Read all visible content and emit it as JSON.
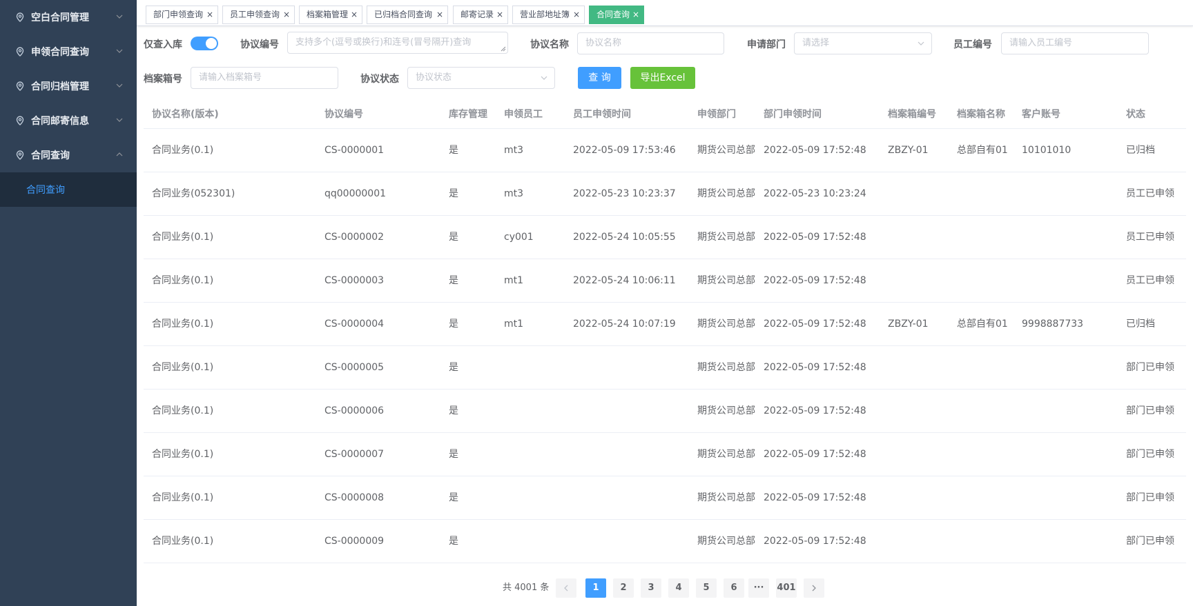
{
  "sidebar": {
    "items": [
      {
        "label": "空白合同管理"
      },
      {
        "label": "申领合同查询"
      },
      {
        "label": "合同归档管理"
      },
      {
        "label": "合同邮寄信息"
      },
      {
        "label": "合同查询"
      }
    ],
    "submenu": [
      {
        "label": "合同查询"
      }
    ]
  },
  "tabs": [
    {
      "label": "部门申领查询"
    },
    {
      "label": "员工申领查询"
    },
    {
      "label": "档案箱管理"
    },
    {
      "label": "已归档合同查询"
    },
    {
      "label": "邮寄记录"
    },
    {
      "label": "营业部地址簿"
    },
    {
      "label": "合同查询",
      "active": true
    }
  ],
  "filters": {
    "in_stock_label": "仅查入库",
    "in_stock_on": true,
    "agreement_no_label": "协议编号",
    "agreement_no_placeholder": "支持多个(逗号或换行)和连号(冒号隔开)查询",
    "agreement_name_label": "协议名称",
    "agreement_name_placeholder": "协议名称",
    "dept_label": "申请部门",
    "dept_placeholder": "请选择",
    "employee_no_label": "员工编号",
    "employee_no_placeholder": "请输入员工编号",
    "box_no_label": "档案箱号",
    "box_no_placeholder": "请输入档案箱号",
    "status_label": "协议状态",
    "status_placeholder": "协议状态",
    "query_button": "查 询",
    "export_button": "导出Excel"
  },
  "table": {
    "columns": [
      "协议名称(版本)",
      "协议编号",
      "库存管理",
      "申领员工",
      "员工申领时间",
      "申领部门",
      "部门申领时间",
      "档案箱编号",
      "档案箱名称",
      "客户账号",
      "状态"
    ],
    "rows": [
      [
        "合同业务(0.1)",
        "CS-0000001",
        "是",
        "mt3",
        "2022-05-09 17:53:46",
        "期货公司总部",
        "2022-05-09 17:52:48",
        "ZBZY-01",
        "总部自有01",
        "10101010",
        "已归档"
      ],
      [
        "合同业务(052301)",
        "qq00000001",
        "是",
        "mt3",
        "2022-05-23 10:23:37",
        "期货公司总部",
        "2022-05-23 10:23:24",
        "",
        "",
        "",
        "员工已申领"
      ],
      [
        "合同业务(0.1)",
        "CS-0000002",
        "是",
        "cy001",
        "2022-05-24 10:05:55",
        "期货公司总部",
        "2022-05-09 17:52:48",
        "",
        "",
        "",
        "员工已申领"
      ],
      [
        "合同业务(0.1)",
        "CS-0000003",
        "是",
        "mt1",
        "2022-05-24 10:06:11",
        "期货公司总部",
        "2022-05-09 17:52:48",
        "",
        "",
        "",
        "员工已申领"
      ],
      [
        "合同业务(0.1)",
        "CS-0000004",
        "是",
        "mt1",
        "2022-05-24 10:07:19",
        "期货公司总部",
        "2022-05-09 17:52:48",
        "ZBZY-01",
        "总部自有01",
        "9998887733",
        "已归档"
      ],
      [
        "合同业务(0.1)",
        "CS-0000005",
        "是",
        "",
        "",
        "期货公司总部",
        "2022-05-09 17:52:48",
        "",
        "",
        "",
        "部门已申领"
      ],
      [
        "合同业务(0.1)",
        "CS-0000006",
        "是",
        "",
        "",
        "期货公司总部",
        "2022-05-09 17:52:48",
        "",
        "",
        "",
        "部门已申领"
      ],
      [
        "合同业务(0.1)",
        "CS-0000007",
        "是",
        "",
        "",
        "期货公司总部",
        "2022-05-09 17:52:48",
        "",
        "",
        "",
        "部门已申领"
      ],
      [
        "合同业务(0.1)",
        "CS-0000008",
        "是",
        "",
        "",
        "期货公司总部",
        "2022-05-09 17:52:48",
        "",
        "",
        "",
        "部门已申领"
      ],
      [
        "合同业务(0.1)",
        "CS-0000009",
        "是",
        "",
        "",
        "期货公司总部",
        "2022-05-09 17:52:48",
        "",
        "",
        "",
        "部门已申领"
      ]
    ]
  },
  "pagination": {
    "total_text": "共 4001 条",
    "pages": [
      "1",
      "2",
      "3",
      "4",
      "5",
      "6",
      "···",
      "401"
    ],
    "current": "1"
  },
  "colors": {
    "sidebar_bg": "#304156",
    "primary": "#409eff",
    "success": "#67c23a",
    "active_tab": "#42b983"
  },
  "icons": {
    "menu_icon": "location-pin-icon",
    "expand": "chevron-down-icon",
    "collapse": "chevron-up-icon",
    "close": "close-icon",
    "prev": "chevron-left-icon",
    "next": "chevron-right-icon"
  }
}
